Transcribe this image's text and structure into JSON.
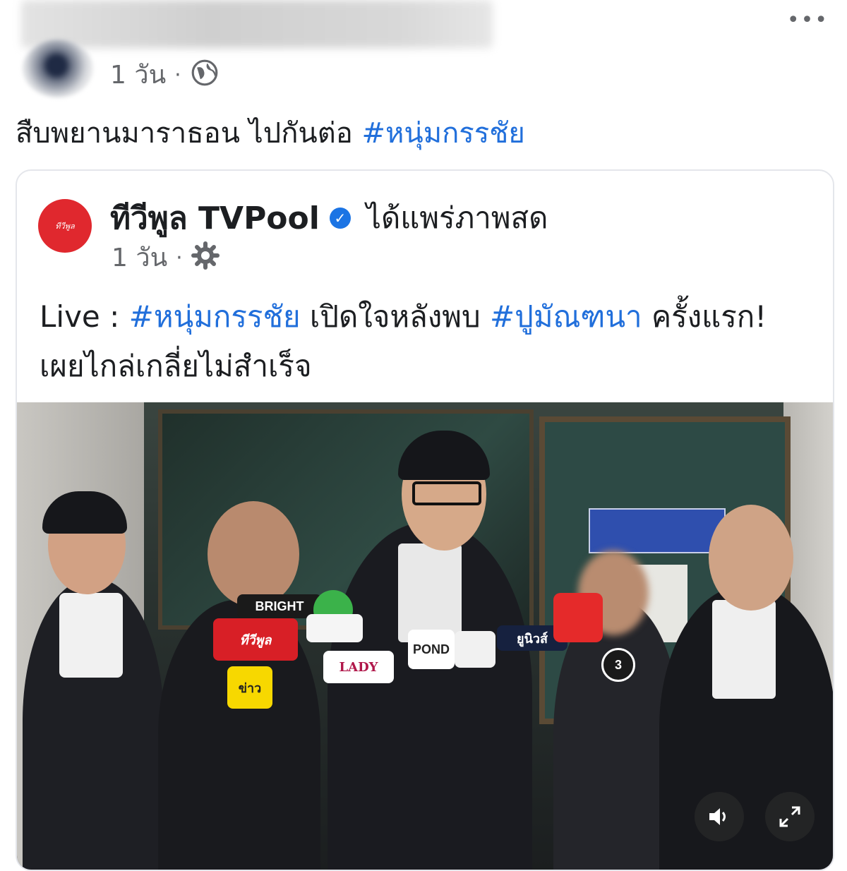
{
  "post": {
    "time": "1 วัน",
    "separator": "·",
    "privacy_icon": "globe-icon",
    "more_label": "•••",
    "text": "สืบพยานมาราธอน ไปกันต่อ",
    "hashtag": "#หนุ่มกรรชัย"
  },
  "shared": {
    "logo_text": "ทีวีพูล",
    "page_name": "ทีวีพูล TVPool",
    "verified_icon": "verified-badge-icon",
    "action": "ได้แพร่ภาพสด",
    "time": "1 วัน",
    "separator": "·",
    "audience_icon": "gear-icon",
    "text_prefix": "Live :",
    "hashtag1": "#หนุ่มกรรชัย",
    "text_mid": "เปิดใจหลังพบ",
    "hashtag2": "#ปูมัณฑนา",
    "text_suffix": "ครั้งแรก! เผยไกล่เกลี่ยไม่สำเร็จ"
  },
  "video": {
    "mic_labels": [
      "BRIGHT",
      "ทีวีพูล",
      "ข่าว",
      "LADY",
      "POND",
      "ยูนิวส์",
      "3"
    ],
    "volume_icon": "speaker-icon",
    "fullscreen_icon": "expand-icon"
  },
  "colors": {
    "hashtag": "#216fdb",
    "verified": "#1b74e4",
    "logo": "#e0282e"
  }
}
